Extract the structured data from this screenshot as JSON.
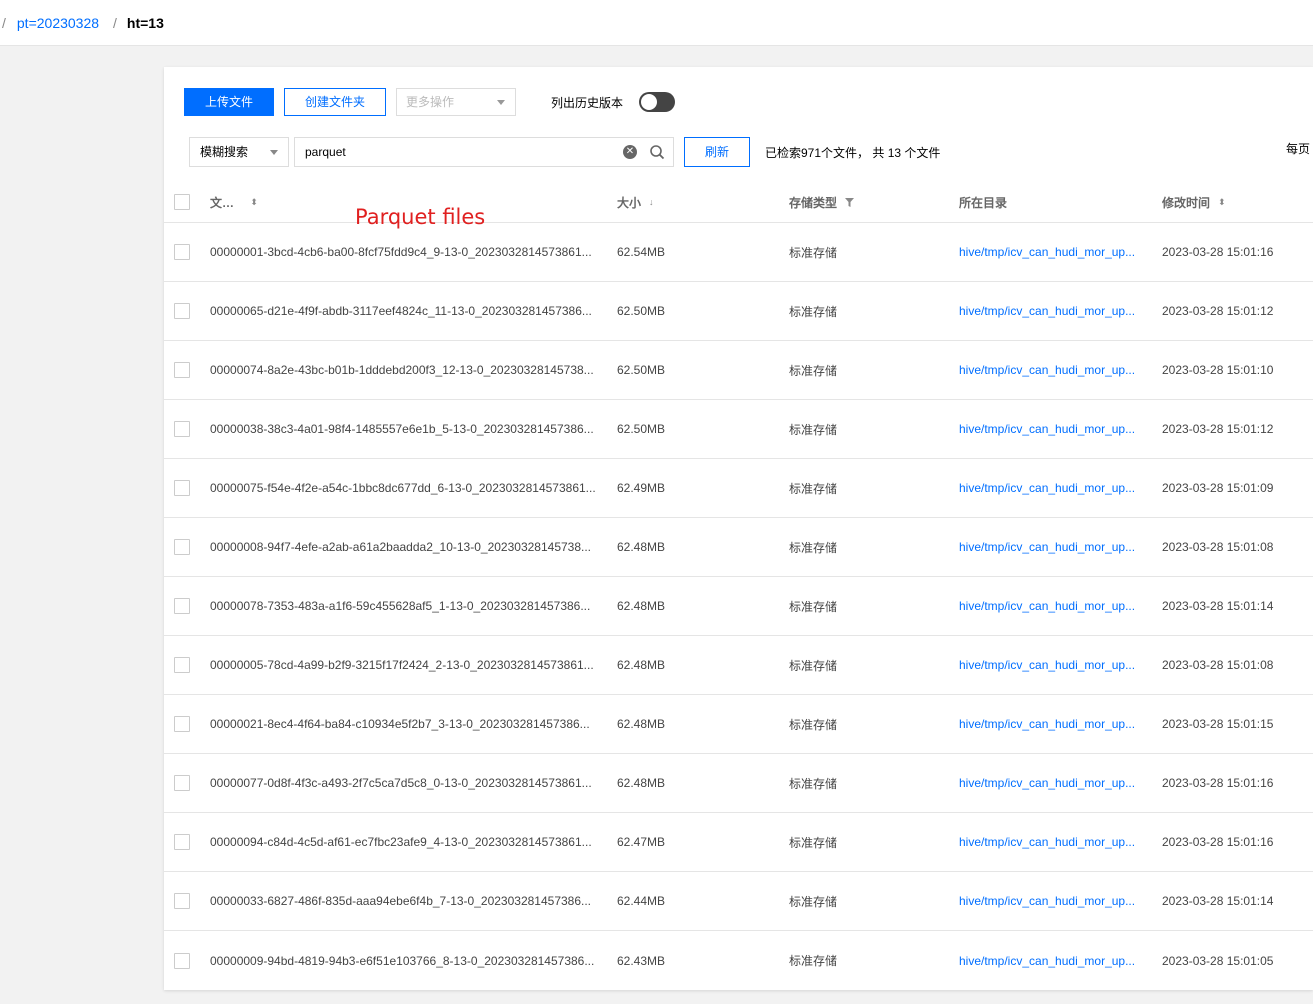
{
  "breadcrumb": {
    "separator": "/",
    "pt_link": "pt=20230328",
    "current": "ht=13"
  },
  "toolbar": {
    "upload": "上传文件",
    "create_folder": "创建文件夹",
    "more_actions": "更多操作",
    "history_label": "列出历史版本",
    "history_enabled": false
  },
  "search": {
    "type": "模糊搜索",
    "query": "parquet",
    "refresh": "刷新",
    "result_text": "已检索971个文件， 共 13 个文件",
    "per_page_label": "每页"
  },
  "annotation": "Parquet files",
  "table": {
    "headers": {
      "name": "文件名",
      "size": "大小",
      "storage_type": "存储类型",
      "directory": "所在目录",
      "modified": "修改时间"
    },
    "rows": [
      {
        "name": "00000001-3bcd-4cb6-ba00-8fcf75fdd9c4_9-13-0_2023032814573861...",
        "size": "62.54MB",
        "type": "标准存储",
        "dir": "hive/tmp/icv_can_hudi_mor_up...",
        "time": "2023-03-28 15:01:16"
      },
      {
        "name": "00000065-d21e-4f9f-abdb-3117eef4824c_11-13-0_202303281457386...",
        "size": "62.50MB",
        "type": "标准存储",
        "dir": "hive/tmp/icv_can_hudi_mor_up...",
        "time": "2023-03-28 15:01:12"
      },
      {
        "name": "00000074-8a2e-43bc-b01b-1dddebd200f3_12-13-0_20230328145738...",
        "size": "62.50MB",
        "type": "标准存储",
        "dir": "hive/tmp/icv_can_hudi_mor_up...",
        "time": "2023-03-28 15:01:10"
      },
      {
        "name": "00000038-38c3-4a01-98f4-1485557e6e1b_5-13-0_202303281457386...",
        "size": "62.50MB",
        "type": "标准存储",
        "dir": "hive/tmp/icv_can_hudi_mor_up...",
        "time": "2023-03-28 15:01:12"
      },
      {
        "name": "00000075-f54e-4f2e-a54c-1bbc8dc677dd_6-13-0_2023032814573861...",
        "size": "62.49MB",
        "type": "标准存储",
        "dir": "hive/tmp/icv_can_hudi_mor_up...",
        "time": "2023-03-28 15:01:09"
      },
      {
        "name": "00000008-94f7-4efe-a2ab-a61a2baadda2_10-13-0_20230328145738...",
        "size": "62.48MB",
        "type": "标准存储",
        "dir": "hive/tmp/icv_can_hudi_mor_up...",
        "time": "2023-03-28 15:01:08"
      },
      {
        "name": "00000078-7353-483a-a1f6-59c455628af5_1-13-0_202303281457386...",
        "size": "62.48MB",
        "type": "标准存储",
        "dir": "hive/tmp/icv_can_hudi_mor_up...",
        "time": "2023-03-28 15:01:14"
      },
      {
        "name": "00000005-78cd-4a99-b2f9-3215f17f2424_2-13-0_2023032814573861...",
        "size": "62.48MB",
        "type": "标准存储",
        "dir": "hive/tmp/icv_can_hudi_mor_up...",
        "time": "2023-03-28 15:01:08"
      },
      {
        "name": "00000021-8ec4-4f64-ba84-c10934e5f2b7_3-13-0_202303281457386...",
        "size": "62.48MB",
        "type": "标准存储",
        "dir": "hive/tmp/icv_can_hudi_mor_up...",
        "time": "2023-03-28 15:01:15"
      },
      {
        "name": "00000077-0d8f-4f3c-a493-2f7c5ca7d5c8_0-13-0_2023032814573861...",
        "size": "62.48MB",
        "type": "标准存储",
        "dir": "hive/tmp/icv_can_hudi_mor_up...",
        "time": "2023-03-28 15:01:16"
      },
      {
        "name": "00000094-c84d-4c5d-af61-ec7fbc23afe9_4-13-0_2023032814573861...",
        "size": "62.47MB",
        "type": "标准存储",
        "dir": "hive/tmp/icv_can_hudi_mor_up...",
        "time": "2023-03-28 15:01:16"
      },
      {
        "name": "00000033-6827-486f-835d-aaa94ebe6f4b_7-13-0_202303281457386...",
        "size": "62.44MB",
        "type": "标准存储",
        "dir": "hive/tmp/icv_can_hudi_mor_up...",
        "time": "2023-03-28 15:01:14"
      },
      {
        "name": "00000009-94bd-4819-94b3-e6f51e103766_8-13-0_202303281457386...",
        "size": "62.43MB",
        "type": "标准存储",
        "dir": "hive/tmp/icv_can_hudi_mor_up...",
        "time": "2023-03-28 15:01:05"
      }
    ]
  }
}
